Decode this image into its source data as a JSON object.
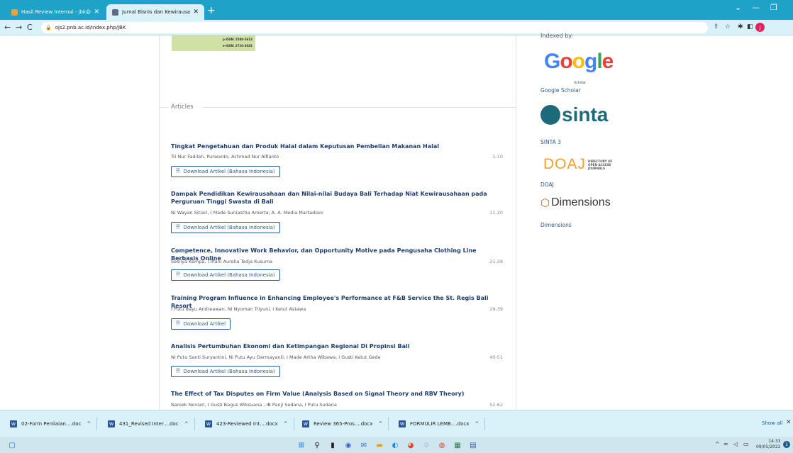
{
  "browser": {
    "tabs": [
      {
        "label": "Hasil Review Internal - jbk@pnb.a",
        "icon_color": "#e8a33a"
      },
      {
        "label": "Jurnal Bisnis dan Kewirausahaan",
        "icon_color": "#5a6e8c"
      }
    ],
    "new_tab": "+",
    "url": "ojs2.pnb.ac.id/index.php/JBK",
    "profile_initial": "J"
  },
  "cover": {
    "issn1": "p-ISSN: 2580-5614",
    "issn2": "e-ISSN: 2716-3643"
  },
  "articles": {
    "section_title": "Articles",
    "items": [
      {
        "title": "Tingkat Pengetahuan dan Produk Halal dalam Keputusan Pembelian Makanan Halal",
        "authors": "Tri Nur Fadilah, Purwanto, Achmad Nur Alfianto",
        "pages": "1-10",
        "download": "Download Artikel (Bahasa Indonesia)"
      },
      {
        "title": "Dampak Pendidikan Kewirausahaan dan Nilai-nilai Budaya Bali Terhadap Niat Kewirausahaan pada Perguruan Tinggi Swasta di Bali",
        "authors": "Ni Wayan Sitiari, I Made Suniastha Amerta, A. A. Media Martadiani",
        "pages": "11-20",
        "download": "Download Artikel (Bahasa Indonesia)"
      },
      {
        "title": "Competence, Innovative Work Behavior, dan Opportunity Motive pada Pengusaha Clothing Line Berbasis Online",
        "authors": "Sesilya Kempa, Tiffani Aurelia Tedja Kusuma",
        "pages": "21-28",
        "download": "Download Artikel (Bahasa Indonesia)"
      },
      {
        "title": "Training Program Influence in Enhancing Employee's Performance at F&B Service the St. Regis Bali Resort",
        "authors": "I Putu Bayu Andreawan, Ni Nyoman Triyuni, I Ketut Astawa",
        "pages": "29-39",
        "download": "Download Artikel"
      },
      {
        "title": "Analisis Pertumbuhan Ekonomi dan Ketimpangan Regional Di Propinsi Bali",
        "authors": "Ni Putu Santi Suryantini, Ni Putu Ayu Darmayanti, I Made Artha Wibawa, I Gusti Ketut Gede",
        "pages": "40-51",
        "download": "Download Artikel (Bahasa Indonesia)"
      },
      {
        "title": "The Effect of Tax Disputes on Firm Value (Analysis Based on Signal Theory and RBV Theory)",
        "authors": "Naniek Noviari, I Gusti Bagus Wiksuana , IB Panji Sedana, I Putu Sudana",
        "pages": "52-62"
      }
    ]
  },
  "sidebar": {
    "header": "Indexed by:",
    "google": {
      "logo_text": "Google",
      "logo_sub": "Scholar",
      "label": "Google Scholar"
    },
    "sinta": {
      "logo_text": "sinta",
      "label": "SINTA 3"
    },
    "doaj": {
      "logo_text": "DOAJ",
      "logo_sub": "DIRECTORY OF OPEN ACCESS JOURNALS",
      "label": "DOAJ"
    },
    "dimensions": {
      "logo_text": "Dimensions",
      "label": "Dimensions"
    }
  },
  "downloads": {
    "items": [
      "02-Form Penilaian....doc",
      "431_Revised Inter....doc",
      "423-Reviewed Int....docx",
      "Review 365-Pros....docx",
      "FORMULIR LEMB....docx"
    ],
    "show_all": "Show all"
  },
  "taskbar": {
    "time": "14:33",
    "date": "09/05/2022",
    "notif_count": "1"
  },
  "colors": {
    "chrome_bar": "#1fa2c8",
    "article_title": "#1d3c6e",
    "link": "#2a5d8c"
  }
}
